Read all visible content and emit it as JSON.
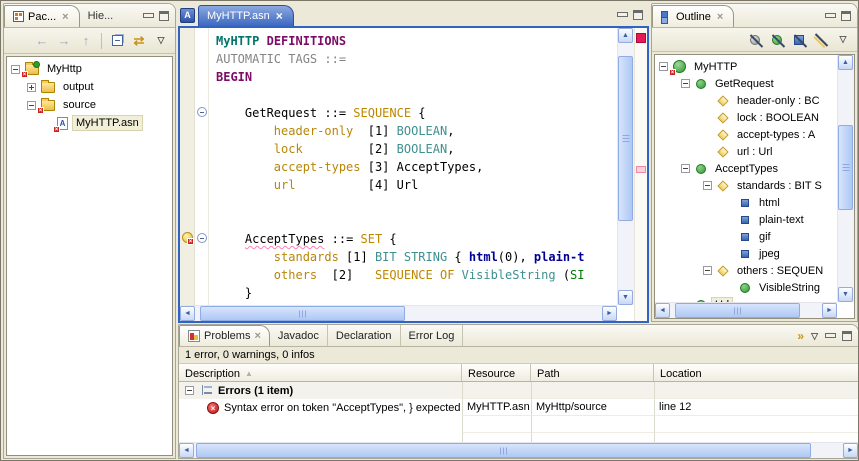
{
  "window": {
    "background": "#ECE9D8",
    "active_part_border": "#3164C2"
  },
  "package_explorer": {
    "tabs": [
      {
        "label": "Pac..."
      },
      {
        "label": "Hie..."
      }
    ],
    "toolbar": [
      {
        "name": "back-icon",
        "glyph": "←"
      },
      {
        "name": "forward-icon",
        "glyph": "→"
      },
      {
        "name": "up-icon",
        "glyph": "↑"
      },
      {
        "name": "separator"
      },
      {
        "name": "collapse-all-icon",
        "shape": "collapse-all"
      },
      {
        "name": "link-with-editor-icon",
        "glyph": "⇄"
      },
      {
        "name": "view-menu-icon",
        "glyph": "▽"
      }
    ],
    "tree": [
      {
        "label": "MyHttp",
        "depth": 0,
        "exp": "minus",
        "icon": "project",
        "error": true
      },
      {
        "label": "output",
        "depth": 1,
        "exp": "plus",
        "icon": "folder",
        "error": false
      },
      {
        "label": "source",
        "depth": 1,
        "exp": "minus",
        "icon": "folder",
        "error": true
      },
      {
        "label": "MyHTTP.asn",
        "depth": 2,
        "exp": "none",
        "icon": "asn-file",
        "error": true,
        "selected": true
      }
    ]
  },
  "editor": {
    "tab_label": "MyHTTP.asn",
    "lines": [
      {
        "tokens": [
          [
            "MyHTTP",
            "mod"
          ],
          [
            " ",
            ""
          ],
          [
            "DEFINITIONS",
            "kw"
          ]
        ]
      },
      {
        "tokens": [
          [
            "AUTOMATIC TAGS ::=",
            "gray"
          ]
        ]
      },
      {
        "tokens": [
          [
            "BEGIN",
            "kw"
          ]
        ]
      },
      {
        "tokens": []
      },
      {
        "fold": "minus",
        "tokens": [
          [
            "    GetRequest ::= ",
            ""
          ],
          [
            "SEQUENCE",
            "kwg"
          ],
          [
            " {",
            ""
          ]
        ]
      },
      {
        "tokens": [
          [
            "        ",
            ""
          ],
          [
            "header-only",
            "fld"
          ],
          [
            "  [1] ",
            ""
          ],
          [
            "BOOLEAN",
            "typ"
          ],
          [
            ",",
            ""
          ]
        ]
      },
      {
        "tokens": [
          [
            "        ",
            ""
          ],
          [
            "lock",
            "fld"
          ],
          [
            "         [2] ",
            ""
          ],
          [
            "BOOLEAN",
            "typ"
          ],
          [
            ",",
            ""
          ]
        ]
      },
      {
        "tokens": [
          [
            "        ",
            ""
          ],
          [
            "accept-types",
            "fld"
          ],
          [
            " [3] AcceptTypes,",
            ""
          ]
        ]
      },
      {
        "tokens": [
          [
            "        ",
            ""
          ],
          [
            "url",
            "fld"
          ],
          [
            "          [4] Url",
            ""
          ]
        ]
      },
      {
        "tokens": []
      },
      {
        "tokens": []
      },
      {
        "fold": "minus",
        "ann": "quickfix-error",
        "tokens": [
          [
            "    ",
            ""
          ],
          [
            "AcceptTypes",
            "err"
          ],
          [
            " ::= ",
            ""
          ],
          [
            "SET",
            "kwg"
          ],
          [
            " {",
            ""
          ]
        ]
      },
      {
        "tokens": [
          [
            "        ",
            ""
          ],
          [
            "standards",
            "fld"
          ],
          [
            " [1] ",
            ""
          ],
          [
            "BIT STRING",
            "typ"
          ],
          [
            " { ",
            ""
          ],
          [
            "html",
            "bit"
          ],
          [
            "(0), ",
            ""
          ],
          [
            "plain-t",
            "bit"
          ]
        ]
      },
      {
        "tokens": [
          [
            "        ",
            ""
          ],
          [
            "others",
            "fld"
          ],
          [
            "  [2]   ",
            ""
          ],
          [
            "SEQUENCE OF",
            "kwg"
          ],
          [
            " ",
            ""
          ],
          [
            "VisibleString",
            "typ"
          ],
          [
            " (",
            ""
          ],
          [
            "SI",
            "size"
          ]
        ]
      },
      {
        "tokens": [
          [
            "    }",
            ""
          ]
        ]
      }
    ]
  },
  "outline": {
    "tab_label": "Outline",
    "toolbar": [
      {
        "name": "hide-variables-icon",
        "shape": "gray-circle"
      },
      {
        "name": "hide-types-icon",
        "shape": "green-circle"
      },
      {
        "name": "hide-named-numbers-icon",
        "shape": "blue-square"
      },
      {
        "name": "hide-fields-icon",
        "shape": "gold-slash"
      },
      {
        "name": "view-menu-icon",
        "glyph": "▽"
      }
    ],
    "tree": [
      {
        "label": "MyHTTP",
        "depth": 0,
        "exp": "minus",
        "icon": "module",
        "error": true
      },
      {
        "label": "GetRequest",
        "depth": 1,
        "exp": "minus",
        "icon": "circle"
      },
      {
        "label": "header-only : BC",
        "depth": 2,
        "exp": "none",
        "icon": "diamond"
      },
      {
        "label": "lock : BOOLEAN",
        "depth": 2,
        "exp": "none",
        "icon": "diamond"
      },
      {
        "label": "accept-types : A",
        "depth": 2,
        "exp": "none",
        "icon": "diamond"
      },
      {
        "label": "url : Url",
        "depth": 2,
        "exp": "none",
        "icon": "diamond"
      },
      {
        "label": "AcceptTypes",
        "depth": 1,
        "exp": "minus",
        "icon": "circle"
      },
      {
        "label": "standards : BIT S",
        "depth": 2,
        "exp": "minus",
        "icon": "diamond"
      },
      {
        "label": "html",
        "depth": 3,
        "exp": "none",
        "icon": "square"
      },
      {
        "label": "plain-text",
        "depth": 3,
        "exp": "none",
        "icon": "square"
      },
      {
        "label": "gif",
        "depth": 3,
        "exp": "none",
        "icon": "square"
      },
      {
        "label": "jpeg",
        "depth": 3,
        "exp": "none",
        "icon": "square"
      },
      {
        "label": "others : SEQUEN",
        "depth": 2,
        "exp": "minus",
        "icon": "diamond"
      },
      {
        "label": "VisibleString",
        "depth": 3,
        "exp": "none",
        "icon": "circle"
      },
      {
        "label": "Url",
        "depth": 1,
        "exp": "none",
        "icon": "circle",
        "selected": true
      }
    ]
  },
  "problems": {
    "tabs": [
      "Problems",
      "Javadoc",
      "Declaration",
      "Error Log"
    ],
    "active_tab": "Problems",
    "status": "1 error, 0 warnings, 0 infos",
    "columns": [
      "Description",
      "Resource",
      "Path",
      "Location"
    ],
    "group_label": "Errors (1 item)",
    "rows": [
      {
        "description": "Syntax error on token \"AcceptTypes\", } expected",
        "resource": "MyHTTP.asn",
        "path": "MyHttp/source",
        "location": "line 12"
      }
    ]
  },
  "syntax_colors": {
    "module_name": "#00756B",
    "keyword": "#7D0A66",
    "comment_gray": "#848484",
    "field_name": "#B8860B",
    "type_keyword": "#BE8700",
    "builtin_type": "#3F8F8F",
    "named_bit": "#000096",
    "constraint": "#007A00",
    "error_squiggle": "#FF82B4"
  }
}
